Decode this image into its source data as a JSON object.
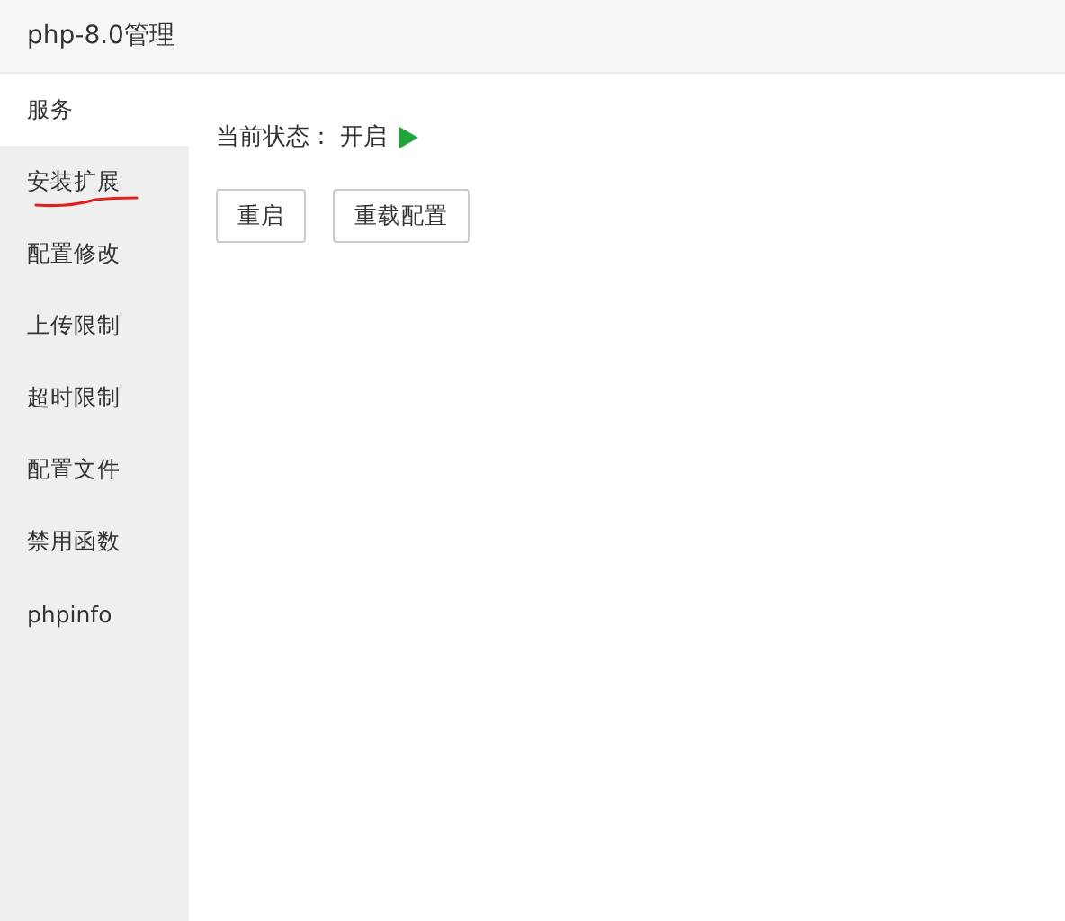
{
  "window": {
    "title": "php-8.0管理"
  },
  "sidebar": {
    "items": [
      {
        "label": "服务",
        "selected": true,
        "underlined": false
      },
      {
        "label": "安装扩展",
        "selected": false,
        "underlined": true
      },
      {
        "label": "配置修改",
        "selected": false,
        "underlined": false
      },
      {
        "label": "上传限制",
        "selected": false,
        "underlined": false
      },
      {
        "label": "超时限制",
        "selected": false,
        "underlined": false
      },
      {
        "label": "配置文件",
        "selected": false,
        "underlined": false
      },
      {
        "label": "禁用函数",
        "selected": false,
        "underlined": false
      },
      {
        "label": "phpinfo",
        "selected": false,
        "underlined": false
      }
    ]
  },
  "status": {
    "label": "当前状态：",
    "value": "开启",
    "running": true
  },
  "buttons": [
    "重启",
    "重载配置"
  ]
}
